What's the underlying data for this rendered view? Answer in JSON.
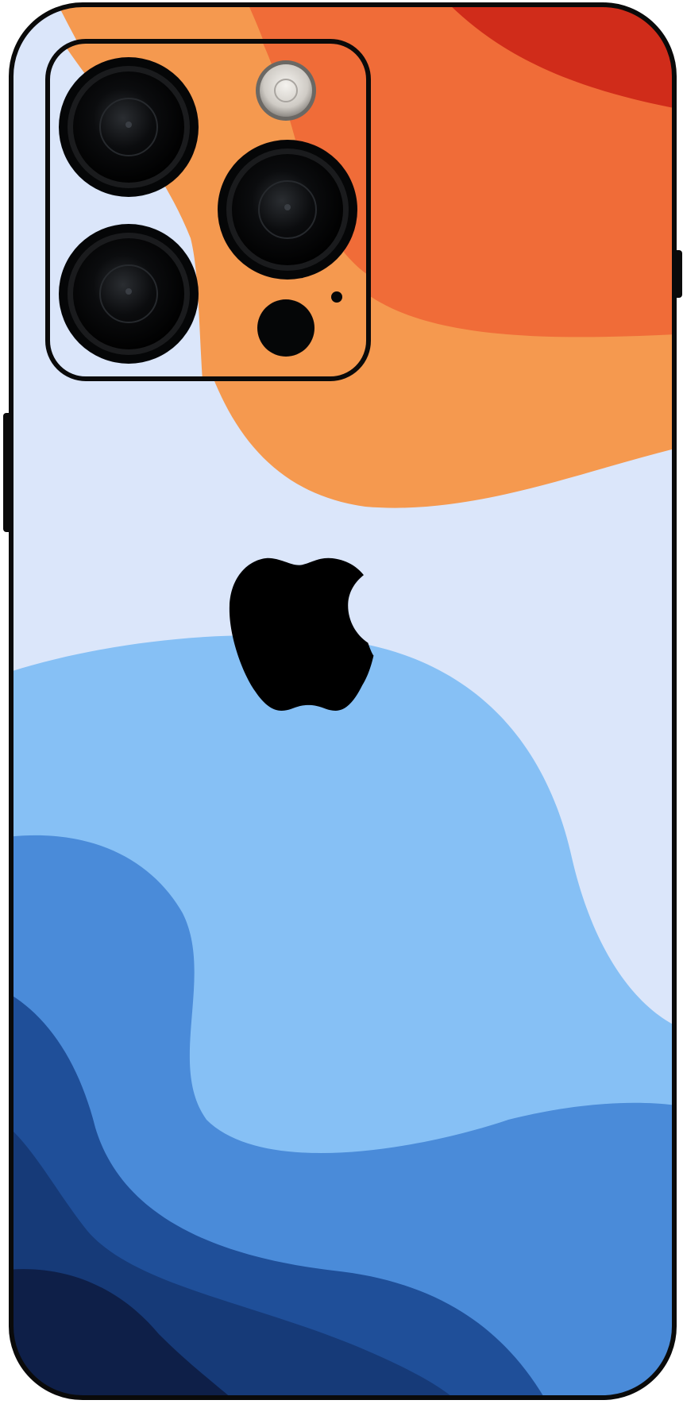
{
  "image": {
    "subject": "smartphone-back-skin",
    "icons": {
      "logo": "apple-logo-icon",
      "flash": "flash-icon",
      "lens": "camera-lens-icon",
      "sensor": "lidar-sensor-icon",
      "microphone": "microphone-icon"
    },
    "colors": {
      "frame": "#0a0a0a",
      "body_pale": "#dbe6fa",
      "orange_light": "#f5994f",
      "orange_mid": "#f06c38",
      "orange_deep": "#d02c1a",
      "blue_sky": "#86c0f5",
      "blue_mid": "#4a8bd9",
      "blue_dark": "#1f4f99",
      "blue_navy": "#163a78",
      "blue_deep": "#0e1f48",
      "lens_black": "#050607",
      "lens_ring": "#1a1b1d",
      "flash_silver": "#dcd9d4",
      "logo": "#000000"
    }
  }
}
